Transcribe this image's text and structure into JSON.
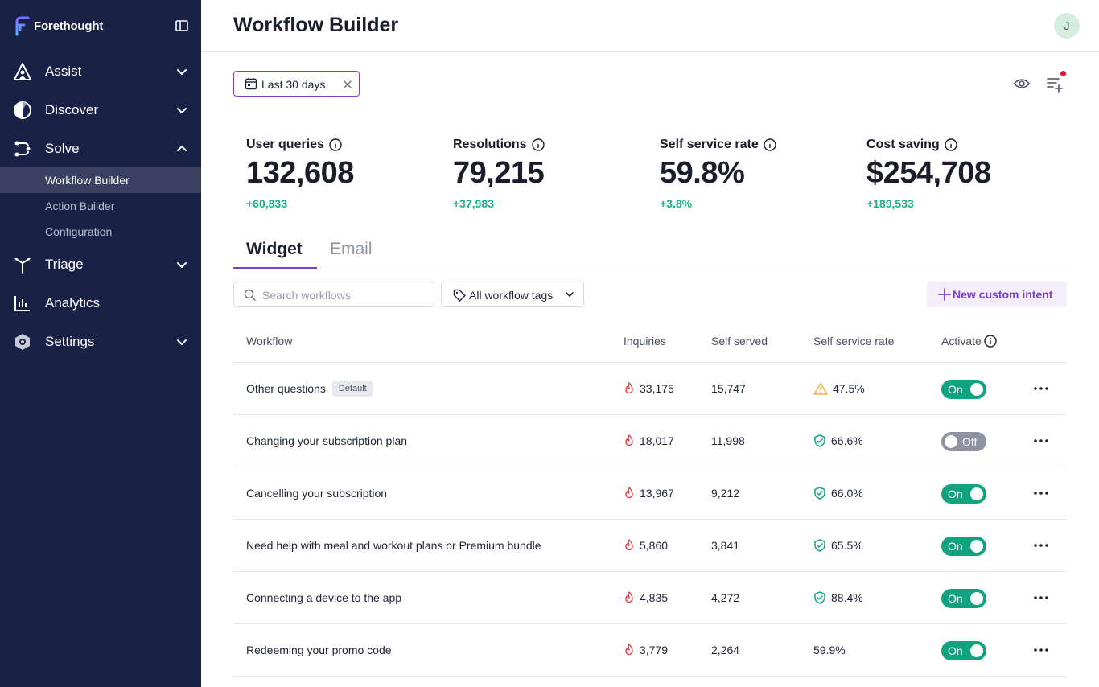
{
  "app": {
    "name": "Forethought"
  },
  "sidebar": {
    "items": [
      {
        "label": "Assist",
        "icon": "assist-icon"
      },
      {
        "label": "Discover",
        "icon": "discover-icon"
      },
      {
        "label": "Solve",
        "icon": "solve-icon",
        "expanded": true
      },
      {
        "label": "Triage",
        "icon": "triage-icon"
      },
      {
        "label": "Analytics",
        "icon": "analytics-icon"
      },
      {
        "label": "Settings",
        "icon": "settings-icon"
      }
    ],
    "solve_children": [
      {
        "label": "Workflow Builder",
        "active": true
      },
      {
        "label": "Action Builder"
      },
      {
        "label": "Configuration"
      }
    ]
  },
  "header": {
    "title": "Workflow Builder",
    "avatar_initial": "J"
  },
  "filters": {
    "date_range": "Last 30 days"
  },
  "metrics": [
    {
      "label": "User queries",
      "value": "132,608",
      "delta": "+60,833"
    },
    {
      "label": "Resolutions",
      "value": "79,215",
      "delta": "+37,983"
    },
    {
      "label": "Self service rate",
      "value": "59.8%",
      "delta": "+3.8%"
    },
    {
      "label": "Cost saving",
      "value": "$254,708",
      "delta": "+189,533"
    }
  ],
  "tabs": [
    {
      "label": "Widget",
      "active": true
    },
    {
      "label": "Email"
    }
  ],
  "toolbar": {
    "search_placeholder": "Search workflows",
    "tag_filter_label": "All workflow tags",
    "new_intent_label": "New custom intent"
  },
  "table": {
    "columns": [
      "Workflow",
      "Inquiries",
      "Self served",
      "Self service rate",
      "Activate"
    ],
    "rows": [
      {
        "workflow": "Other questions",
        "badge": "Default",
        "inquiries": "33,175",
        "self_served": "15,747",
        "rate": "47.5%",
        "rate_icon": "warning-icon",
        "active": "On"
      },
      {
        "workflow": "Changing your subscription plan",
        "inquiries": "18,017",
        "self_served": "11,998",
        "rate": "66.6%",
        "rate_icon": "shield-check-icon",
        "active": "Off"
      },
      {
        "workflow": "Cancelling your subscription",
        "inquiries": "13,967",
        "self_served": "9,212",
        "rate": "66.0%",
        "rate_icon": "shield-check-icon",
        "active": "On"
      },
      {
        "workflow": "Need help with meal and workout plans or Premium bundle",
        "inquiries": "5,860",
        "self_served": "3,841",
        "rate": "65.5%",
        "rate_icon": "shield-check-icon",
        "active": "On"
      },
      {
        "workflow": "Connecting a device to the app",
        "inquiries": "4,835",
        "self_served": "4,272",
        "rate": "88.4%",
        "rate_icon": "shield-check-icon",
        "active": "On"
      },
      {
        "workflow": "Redeeming your promo code",
        "inquiries": "3,779",
        "self_served": "2,264",
        "rate": "59.9%",
        "rate_icon": "",
        "active": "On"
      }
    ]
  },
  "colors": {
    "sidebar_bg": "#1a2146",
    "accent_purple": "#7b3fd1",
    "positive_green": "#14b38a",
    "toggle_on": "#11a37f",
    "toggle_off": "#8f92a0",
    "fire_red": "#e5484d",
    "warning_amber": "#f2b23a",
    "shield_green": "#11a37f"
  }
}
